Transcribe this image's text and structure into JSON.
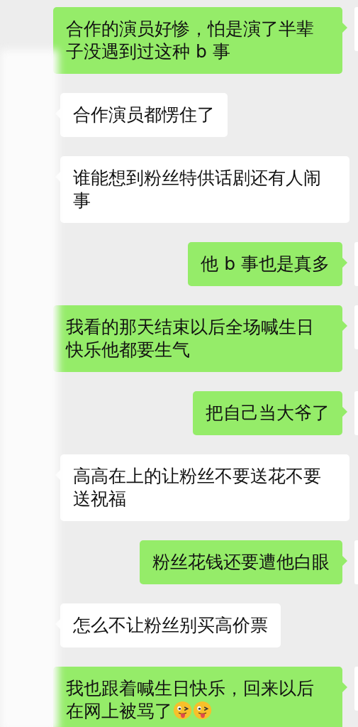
{
  "messages": [
    {
      "kind": "sent",
      "text": "合作的演员好惨，怕是演了半辈子没遇到过这种 b 事"
    },
    {
      "kind": "received",
      "text": "合作演员都愣住了"
    },
    {
      "kind": "received",
      "text": "谁能想到粉丝特供话剧还有人闹事"
    },
    {
      "kind": "sent",
      "text": "他 b 事也是真多"
    },
    {
      "kind": "sent",
      "text": "我看的那天结束以后全场喊生日快乐他都要生气"
    },
    {
      "kind": "sent",
      "text": "把自己当大爷了"
    },
    {
      "kind": "received",
      "text": "高高在上的让粉丝不要送花不要送祝福"
    },
    {
      "kind": "sent",
      "text": "粉丝花钱还要遭他白眼"
    },
    {
      "kind": "received",
      "text": "怎么不让粉丝别买高价票"
    },
    {
      "kind": "sent",
      "text": "我也跟着喊生日快乐，回来以后在网上被骂了",
      "emojis": [
        {
          "kind": "wink"
        },
        {
          "kind": "wink"
        }
      ]
    }
  ]
}
